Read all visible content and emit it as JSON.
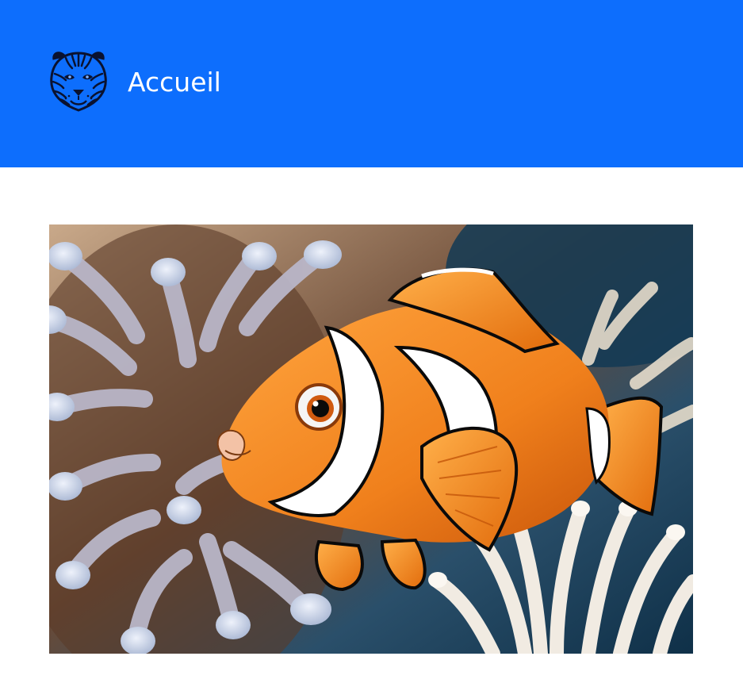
{
  "header": {
    "title": "Accueil",
    "logo_icon": "tiger-head-icon",
    "background_color": "#0d6efd"
  },
  "hero": {
    "image_icon": "clownfish-anemone-image"
  }
}
